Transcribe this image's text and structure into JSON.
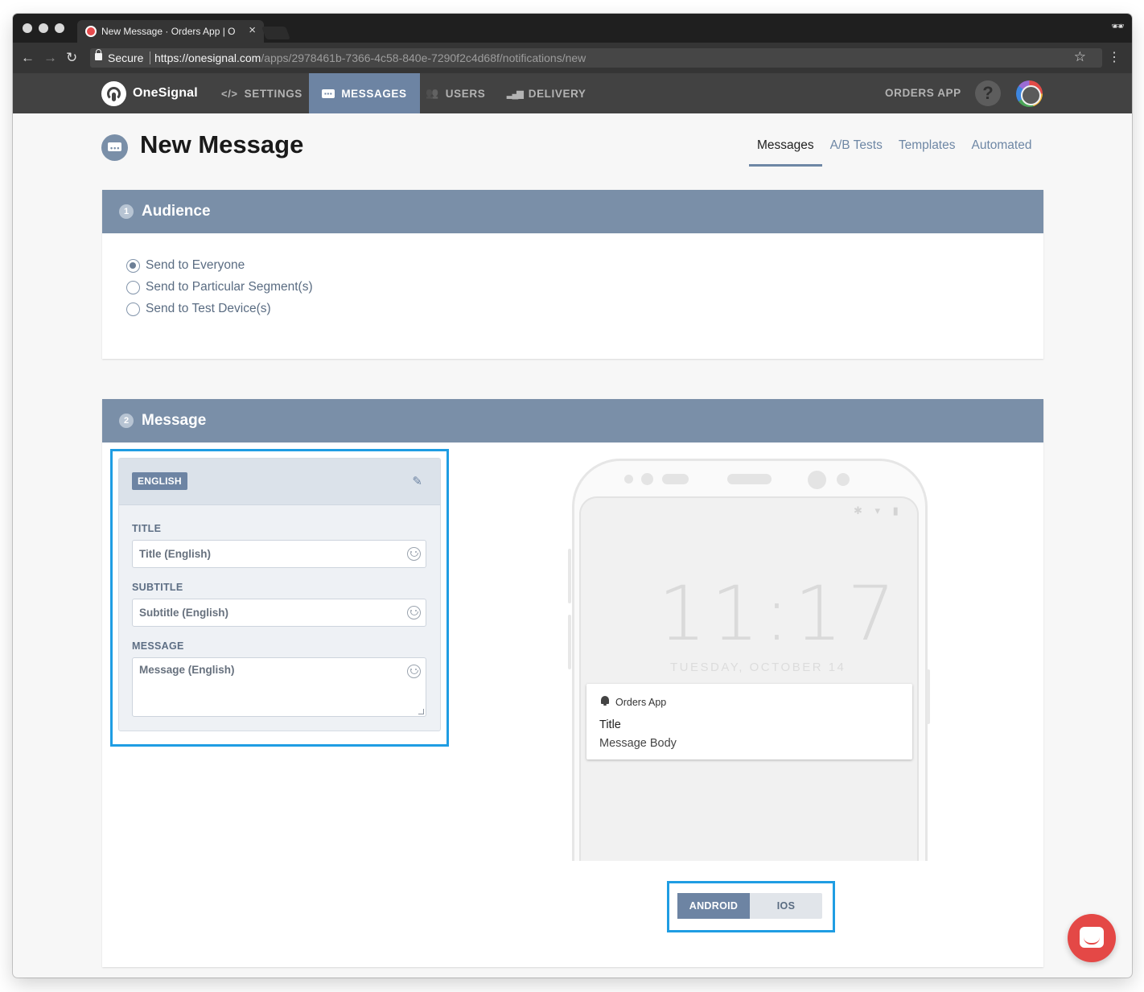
{
  "browser": {
    "tab_title": "New Message · Orders App | O",
    "tab_close": "×",
    "secure_label": "Secure",
    "url_scheme": "https://",
    "url_host": "onesignal.com",
    "url_path": "/apps/2978461b-7366-4c58-840e-7290f2c4d68f/notifications/new",
    "back_icon": "←",
    "forward_icon": "→",
    "reload_icon": "↻",
    "star_icon": "☆",
    "menu_icon": "⋮",
    "incognito_icon": "🕶"
  },
  "appnav": {
    "brand": "OneSignal",
    "items": [
      {
        "icon": "</>",
        "label": "SETTINGS"
      },
      {
        "icon": "▪▪▪",
        "label": "MESSAGES"
      },
      {
        "icon": "👥",
        "label": "USERS"
      },
      {
        "icon": "▂▄▆",
        "label": "DELIVERY"
      }
    ],
    "app_name": "ORDERS APP",
    "help": "?"
  },
  "page": {
    "title": "New Message",
    "icon_glyph": "•••",
    "tabs": [
      "Messages",
      "A/B Tests",
      "Templates",
      "Automated"
    ],
    "active_tab": "Messages"
  },
  "audience": {
    "number": "1",
    "title": "Audience",
    "options": [
      "Send to Everyone",
      "Send to Particular Segment(s)",
      "Send to Test Device(s)"
    ],
    "selected": "Send to Everyone"
  },
  "message": {
    "number": "2",
    "title": "Message",
    "language_badge": "ENGLISH",
    "edit_icon": "✎",
    "fields": [
      {
        "label": "TITLE",
        "placeholder": "Title (English)"
      },
      {
        "label": "SUBTITLE",
        "placeholder": "Subtitle (English)"
      },
      {
        "label": "MESSAGE",
        "placeholder": "Message (English)"
      }
    ]
  },
  "preview": {
    "status_icons": "✱ ▾ ▮",
    "time": "11:17",
    "date": "TUESDAY, OCTOBER 14",
    "notification": {
      "app": "Orders App",
      "title": "Title",
      "body": "Message Body"
    },
    "platforms": [
      "ANDROID",
      "IOS"
    ],
    "selected_platform": "ANDROID"
  },
  "colors": {
    "accent": "#6d84a3",
    "highlight": "#1f9de3",
    "chat": "#e44846"
  }
}
